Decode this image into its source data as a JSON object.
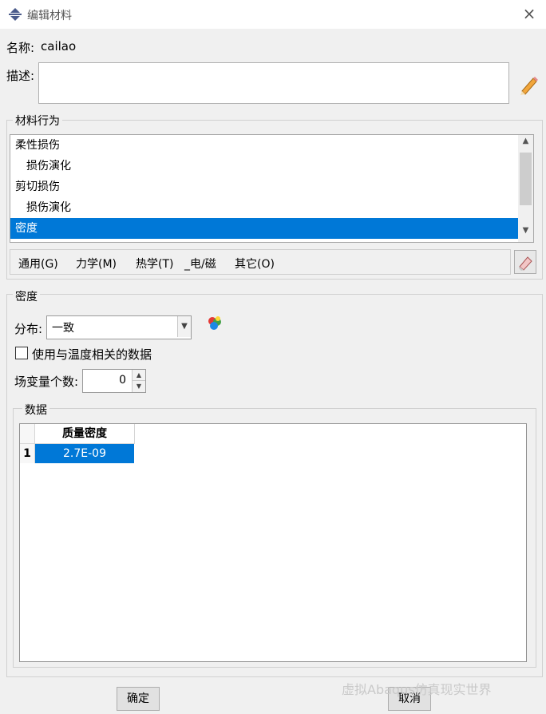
{
  "window": {
    "title": "编辑材料",
    "icon": "abaqus-app-icon",
    "close": "×"
  },
  "name": {
    "label": "名称:",
    "value": "cailao"
  },
  "description": {
    "label": "描述:",
    "value": ""
  },
  "material_behaviors": {
    "title": "材料行为",
    "items": [
      {
        "label": "柔性损伤",
        "indent": false,
        "selected": false
      },
      {
        "label": "损伤演化",
        "indent": true,
        "selected": false
      },
      {
        "label": "剪切损伤",
        "indent": false,
        "selected": false
      },
      {
        "label": "损伤演化",
        "indent": true,
        "selected": false
      },
      {
        "label": "密度",
        "indent": false,
        "selected": true
      }
    ],
    "menus": [
      "通用(G)",
      "力学(M)",
      "热学(T)",
      "_电/磁",
      "其它(O)"
    ]
  },
  "density": {
    "title": "密度",
    "distribution_label": "分布:",
    "distribution_value": "一致",
    "temp_dependent_label": "使用与温度相关的数据",
    "temp_dependent_checked": false,
    "field_vars_label": "场变量个数:",
    "field_vars_value": "0",
    "data_title": "数据",
    "table": {
      "columns": [
        "质量密度"
      ],
      "rows": [
        {
          "index": "1",
          "values": [
            "2.7E-09"
          ]
        }
      ]
    }
  },
  "buttons": {
    "ok": "确定",
    "cancel": "取消"
  },
  "watermark": "虚拟Abaqus仿真现实世界",
  "colors": {
    "selection": "#0078d7",
    "dialog_bg": "#f0f0f0"
  }
}
